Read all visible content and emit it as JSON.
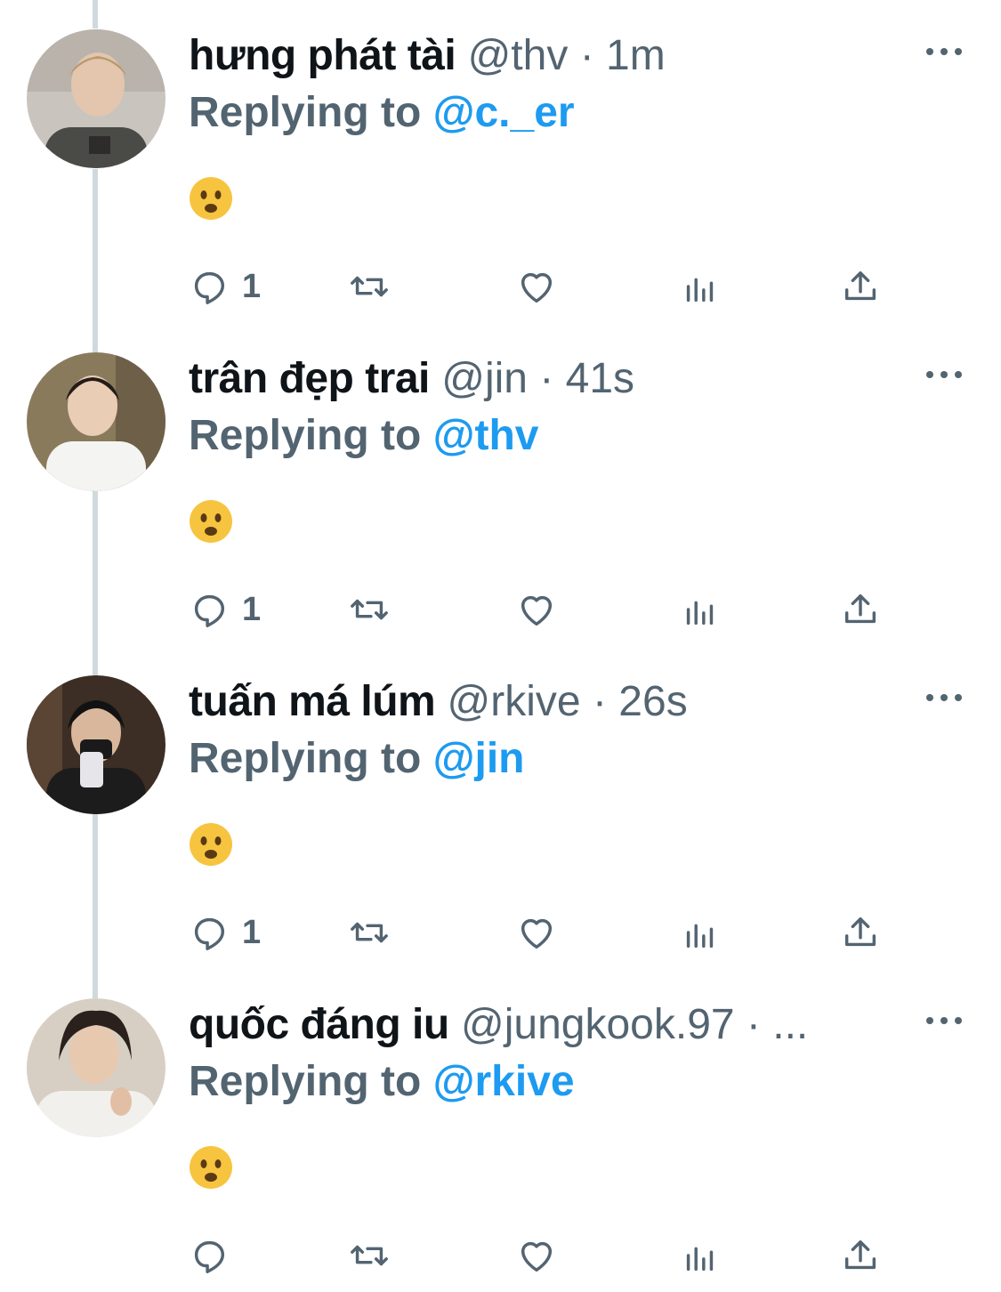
{
  "colors": {
    "accent": "#1d9bf0",
    "secondary_text": "#536471",
    "primary_text": "#0f1419",
    "thread_line": "#cfd9de"
  },
  "tweets": [
    {
      "display_name": "hưng phát tài",
      "handle": "@thv",
      "separator": "·",
      "time": "1m",
      "reply_prefix": "Replying to",
      "reply_to": "@c._er",
      "content_emoji": "frowning-face-emoji",
      "reply_count": "1"
    },
    {
      "display_name": "trân đẹp trai",
      "handle": "@jin",
      "separator": "·",
      "time": "41s",
      "reply_prefix": "Replying to",
      "reply_to": "@thv",
      "content_emoji": "frowning-face-emoji",
      "reply_count": "1"
    },
    {
      "display_name": "tuấn má lúm",
      "handle": "@rkive",
      "separator": "·",
      "time": "26s",
      "reply_prefix": "Replying to",
      "reply_to": "@jin",
      "content_emoji": "frowning-face-emoji",
      "reply_count": "1"
    },
    {
      "display_name": "quốc đáng iu",
      "handle": "@jungkook.97",
      "separator": "·",
      "time": "",
      "truncation": "...",
      "reply_prefix": "Replying to",
      "reply_to": "@rkive",
      "content_emoji": "frowning-face-emoji",
      "reply_count": ""
    }
  ]
}
